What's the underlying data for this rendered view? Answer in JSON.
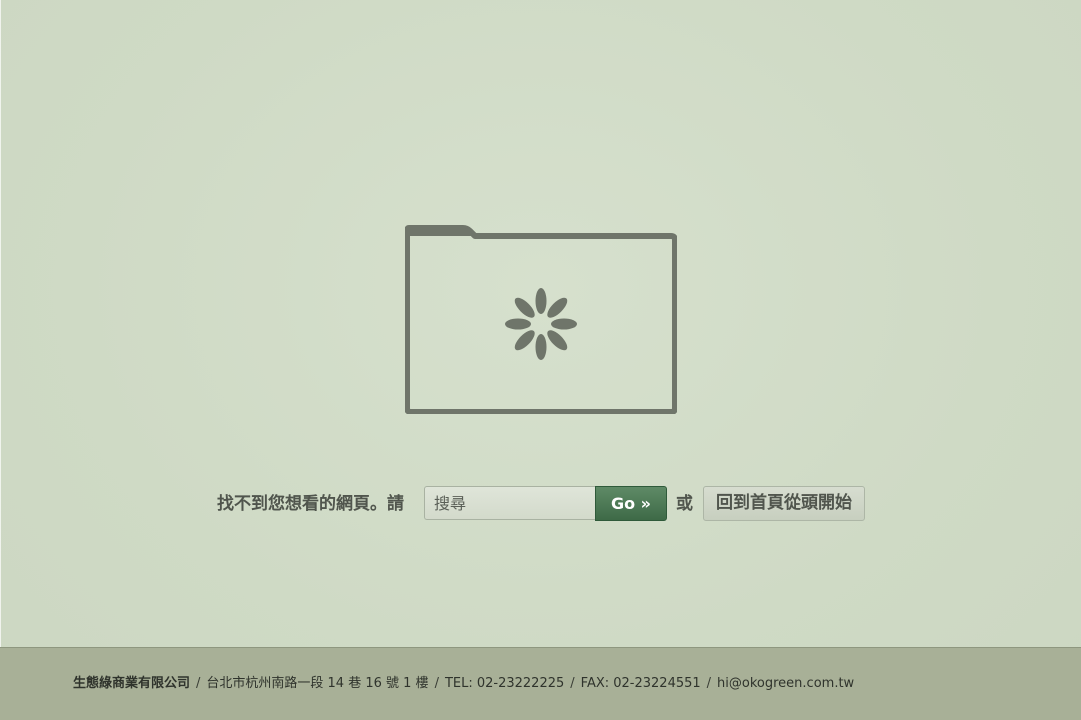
{
  "icons": {
    "folder": "folder-icon",
    "spinner": "loading-spinner-icon"
  },
  "colors": {
    "background": "#d0dbc6",
    "folder_stroke": "#6f756a",
    "go_button": "#4a7752",
    "footer": "#a8b097"
  },
  "search_row": {
    "prompt": "找不到您想看的網頁。請",
    "search_placeholder": "搜尋",
    "go_label": "Go »",
    "or_text": "或",
    "home_label": "回到首頁從頭開始"
  },
  "footer": {
    "company": "生態綠商業有限公司",
    "address": "台北市杭州南路一段 14 巷 16 號 1 樓",
    "tel": "TEL: 02-23222225",
    "fax": "FAX: 02-23224551",
    "email": "hi@okogreen.com.tw",
    "separator": "/"
  }
}
